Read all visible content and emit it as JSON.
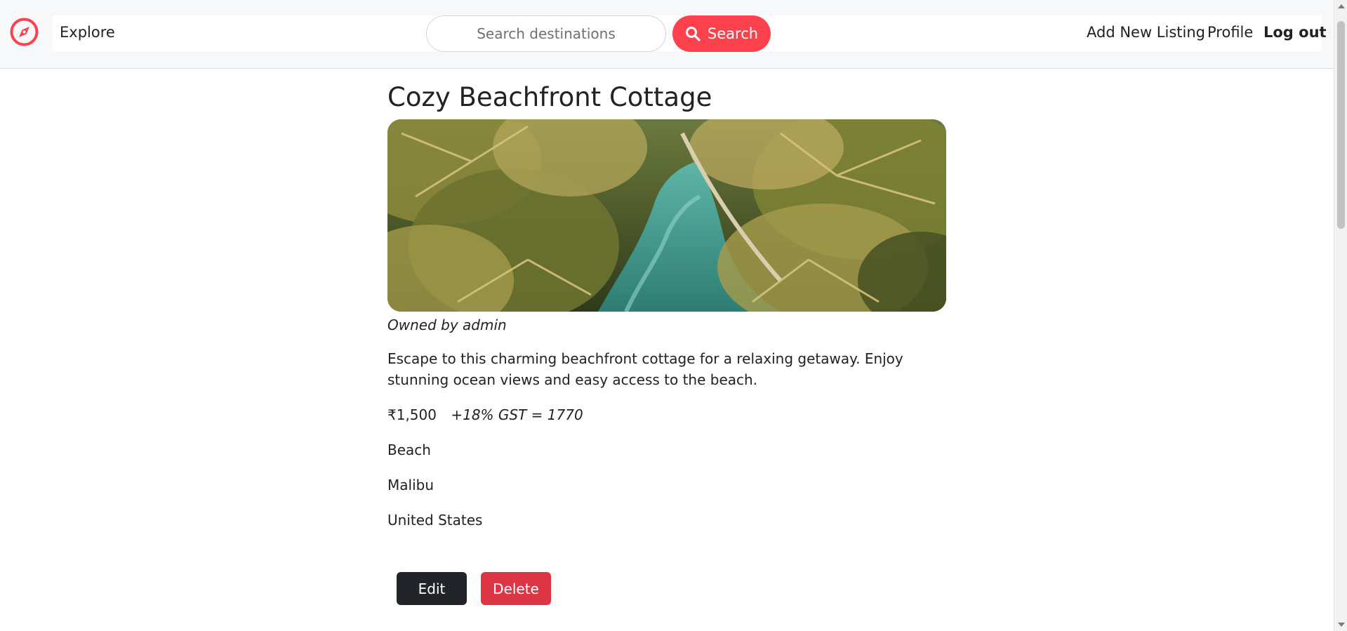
{
  "navbar": {
    "brand_icon": "compass-icon",
    "explore_label": "Explore",
    "search": {
      "placeholder": "Search destinations",
      "value": "",
      "button_label": "Search",
      "button_icon": "search-icon"
    },
    "add_listing_label": "Add New Listing",
    "profile_label": "Profile",
    "logout_label": "Log out"
  },
  "listing": {
    "title": "Cozy Beachfront Cottage",
    "owner_text": "Owned by admin",
    "description": "Escape to this charming beachfront cottage for a relaxing getaway. Enjoy stunning ocean views and easy access to the beach.",
    "price": "₹1,500",
    "tax_note": "+18% GST = 1770",
    "category": "Beach",
    "location": "Malibu",
    "country": "United States"
  },
  "actions": {
    "edit_label": "Edit",
    "delete_label": "Delete"
  },
  "colors": {
    "brand": "#fe424d",
    "edit_button": "#212529",
    "delete_button": "#dc3545",
    "navbar_bg": "#f7f8f9"
  }
}
